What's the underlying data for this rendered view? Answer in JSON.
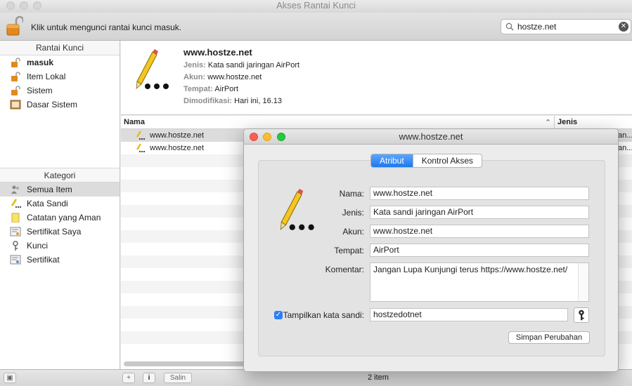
{
  "window": {
    "title": "Akses Rantai Kunci"
  },
  "toolbar": {
    "lock_message": "Klik untuk mengunci rantai kunci masuk.",
    "search_value": "hostze.net"
  },
  "sidebar": {
    "keychains_header": "Rantai Kunci",
    "keychains": [
      {
        "label": "masuk",
        "icon": "lock-open-icon"
      },
      {
        "label": "Item Lokal",
        "icon": "lock-open-icon"
      },
      {
        "label": "Sistem",
        "icon": "lock-open-icon"
      },
      {
        "label": "Dasar Sistem",
        "icon": "cabinet-icon"
      }
    ],
    "categories_header": "Kategori",
    "categories": [
      {
        "label": "Semua Item",
        "icon": "people-icon"
      },
      {
        "label": "Kata Sandi",
        "icon": "pencil-icon"
      },
      {
        "label": "Catatan yang Aman",
        "icon": "note-icon"
      },
      {
        "label": "Sertifikat Saya",
        "icon": "certificate-icon"
      },
      {
        "label": "Kunci",
        "icon": "key-icon"
      },
      {
        "label": "Sertifikat",
        "icon": "certificate-icon"
      }
    ]
  },
  "info": {
    "title": "www.hostze.net",
    "jenis_label": "Jenis:",
    "jenis_value": "Kata sandi jaringan AirPort",
    "akun_label": "Akun:",
    "akun_value": "www.hostze.net",
    "tempat_label": "Tempat:",
    "tempat_value": "AirPort",
    "dimodifikasi_label": "Dimodifikasi:",
    "dimodifikasi_value": "Hari ini, 16.13"
  },
  "table": {
    "col_nama": "Nama",
    "col_jenis": "Jenis",
    "rows": [
      {
        "nama": "www.hostze.net",
        "jenis": "an..."
      },
      {
        "nama": "www.hostze.net",
        "jenis": "an..."
      }
    ]
  },
  "bottombar": {
    "add": "+",
    "info": "i",
    "copy": "Salin",
    "count": "2 item"
  },
  "dialog": {
    "title": "www.hostze.net",
    "tab_attributes": "Atribut",
    "tab_access": "Kontrol Akses",
    "nama_label": "Nama:",
    "nama_value": "www.hostze.net",
    "jenis_label": "Jenis:",
    "jenis_value": "Kata sandi jaringan AirPort",
    "akun_label": "Akun:",
    "akun_value": "www.hostze.net",
    "tempat_label": "Tempat:",
    "tempat_value": "AirPort",
    "komentar_label": "Komentar:",
    "komentar_value": "Jangan Lupa Kunjungi terus https://www.hostze.net/",
    "show_password_label": "Tampilkan kata sandi:",
    "show_password_checked": "✓",
    "password_value": "hostzedotnet",
    "save_label": "Simpan Perubahan"
  },
  "colors": {
    "accent": "#1e78ef",
    "close": "#fc5f57",
    "minimize": "#fdbc2e",
    "zoom": "#28c840"
  }
}
